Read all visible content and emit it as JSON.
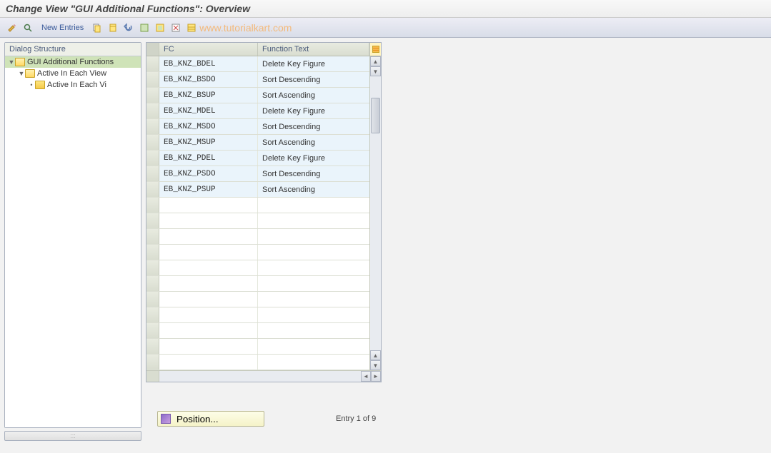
{
  "title": "Change View \"GUI Additional Functions\": Overview",
  "toolbar": {
    "new_entries": "New Entries"
  },
  "watermark": "www.tutorialkart.com",
  "sidebar": {
    "header": "Dialog Structure",
    "items": [
      {
        "label": "GUI Additional Functions",
        "level": 0,
        "open": true,
        "selected": true
      },
      {
        "label": "Active In Each View",
        "level": 1,
        "open": true,
        "selected": false
      },
      {
        "label": "Active In Each Vi",
        "level": 2,
        "open": false,
        "selected": false
      }
    ]
  },
  "table": {
    "col_fc": "FC",
    "col_ft": "Function Text",
    "rows": [
      {
        "fc": "EB_KNZ_BDEL",
        "ft": "Delete Key Figure"
      },
      {
        "fc": "EB_KNZ_BSDO",
        "ft": "Sort Descending"
      },
      {
        "fc": "EB_KNZ_BSUP",
        "ft": "Sort Ascending"
      },
      {
        "fc": "EB_KNZ_MDEL",
        "ft": "Delete Key Figure"
      },
      {
        "fc": "EB_KNZ_MSDO",
        "ft": "Sort Descending"
      },
      {
        "fc": "EB_KNZ_MSUP",
        "ft": "Sort Ascending"
      },
      {
        "fc": "EB_KNZ_PDEL",
        "ft": "Delete Key Figure"
      },
      {
        "fc": "EB_KNZ_PSDO",
        "ft": "Sort Descending"
      },
      {
        "fc": "EB_KNZ_PSUP",
        "ft": "Sort Ascending"
      }
    ],
    "empty_rows": 11
  },
  "footer": {
    "position_label": "Position...",
    "entry_text": "Entry 1 of 9"
  }
}
